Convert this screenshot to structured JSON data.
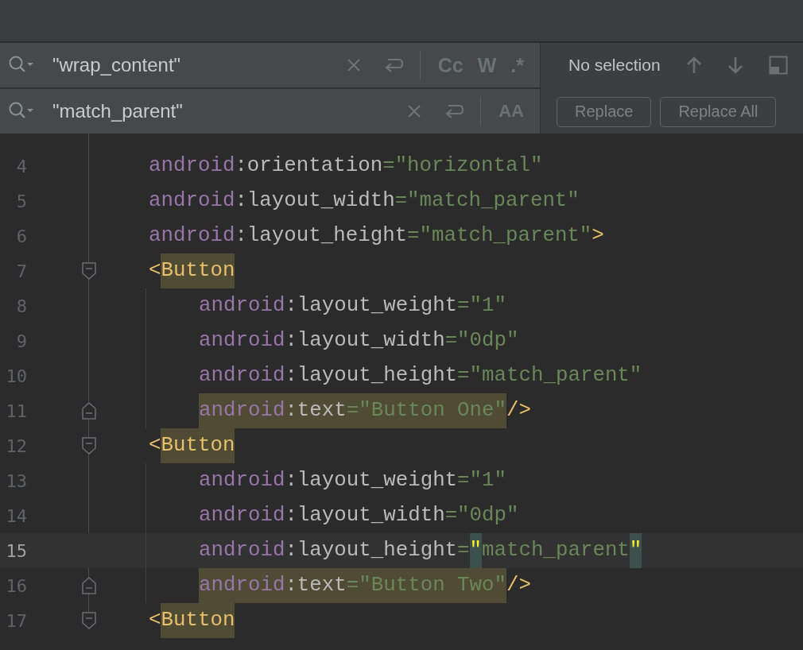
{
  "search": {
    "find_value": "\"wrap_content\"",
    "replace_value": "\"match_parent\"",
    "find_options": [
      {
        "label": "Cc",
        "selected": false
      },
      {
        "label": "W",
        "selected": false
      },
      {
        "label": ".*",
        "selected": false
      }
    ],
    "preserve_case_label": "AA",
    "status": "No selection",
    "buttons": [
      {
        "label": "Replace",
        "disabled": true
      },
      {
        "label": "Replace All",
        "disabled": true
      }
    ]
  },
  "lines": [
    {
      "number": "4",
      "current": false,
      "fold_start": false,
      "fold_end": false,
      "tokens": [
        {
          "kind": "namespace",
          "text": "android",
          "search_hit": false,
          "brace_match": false
        },
        {
          "kind": "punct",
          "text": ":orientation",
          "search_hit": false,
          "brace_match": false
        },
        {
          "kind": "string",
          "text": "=\"horizontal\"",
          "search_hit": false,
          "brace_match": false
        }
      ]
    },
    {
      "number": "5",
      "current": false,
      "fold_start": false,
      "fold_end": false,
      "tokens": [
        {
          "kind": "namespace",
          "text": "android",
          "search_hit": false,
          "brace_match": false
        },
        {
          "kind": "punct",
          "text": ":layout_width",
          "search_hit": false,
          "brace_match": false
        },
        {
          "kind": "string",
          "text": "=\"match_parent\"",
          "search_hit": false,
          "brace_match": false
        }
      ]
    },
    {
      "number": "6",
      "current": false,
      "fold_start": false,
      "fold_end": false,
      "tokens": [
        {
          "kind": "namespace",
          "text": "android",
          "search_hit": false,
          "brace_match": false
        },
        {
          "kind": "punct",
          "text": ":layout_height",
          "search_hit": false,
          "brace_match": false
        },
        {
          "kind": "string",
          "text": "=\"match_parent\"",
          "search_hit": false,
          "brace_match": false
        },
        {
          "kind": "tag",
          "text": ">",
          "search_hit": false,
          "brace_match": false
        }
      ]
    },
    {
      "number": "7",
      "current": false,
      "fold_start": true,
      "fold_end": false,
      "tokens": [
        {
          "kind": "tag",
          "text": "<",
          "search_hit": false,
          "brace_match": false
        },
        {
          "kind": "tag",
          "text": "Button",
          "search_hit": true,
          "brace_match": false
        }
      ],
      "children": [
        {
          "number": "8",
          "current": false,
          "fold_start": false,
          "fold_end": false,
          "tokens": [
            {
              "kind": "namespace",
              "text": "android",
              "search_hit": false,
              "brace_match": false
            },
            {
              "kind": "punct",
              "text": ":layout_weight",
              "search_hit": false,
              "brace_match": false
            },
            {
              "kind": "string",
              "text": "=\"1\"",
              "search_hit": false,
              "brace_match": false
            }
          ]
        },
        {
          "number": "9",
          "current": false,
          "fold_start": false,
          "fold_end": false,
          "tokens": [
            {
              "kind": "namespace",
              "text": "android",
              "search_hit": false,
              "brace_match": false
            },
            {
              "kind": "punct",
              "text": ":layout_width",
              "search_hit": false,
              "brace_match": false
            },
            {
              "kind": "string",
              "text": "=\"0dp\"",
              "search_hit": false,
              "brace_match": false
            }
          ]
        },
        {
          "number": "10",
          "current": false,
          "fold_start": false,
          "fold_end": false,
          "tokens": [
            {
              "kind": "namespace",
              "text": "android",
              "search_hit": false,
              "brace_match": false
            },
            {
              "kind": "punct",
              "text": ":layout_height",
              "search_hit": false,
              "brace_match": false
            },
            {
              "kind": "string",
              "text": "=\"match_parent\"",
              "search_hit": false,
              "brace_match": false
            }
          ]
        },
        {
          "number": "11",
          "current": false,
          "fold_start": false,
          "fold_end": true,
          "tokens": [
            {
              "kind": "namespace",
              "text": "android",
              "search_hit": true,
              "brace_match": false
            },
            {
              "kind": "punct",
              "text": ":text",
              "search_hit": true,
              "brace_match": false
            },
            {
              "kind": "string",
              "text": "=\"Button One\"",
              "search_hit": true,
              "brace_match": false
            },
            {
              "kind": "tag",
              "text": "/>",
              "search_hit": false,
              "brace_match": false
            }
          ]
        }
      ]
    },
    {
      "number": "12",
      "current": false,
      "fold_start": true,
      "fold_end": false,
      "tokens": [
        {
          "kind": "tag",
          "text": "<",
          "search_hit": false,
          "brace_match": false
        },
        {
          "kind": "tag",
          "text": "Button",
          "search_hit": true,
          "brace_match": false
        }
      ],
      "children": [
        {
          "number": "13",
          "current": false,
          "fold_start": false,
          "fold_end": false,
          "tokens": [
            {
              "kind": "namespace",
              "text": "android",
              "search_hit": false,
              "brace_match": false
            },
            {
              "kind": "punct",
              "text": ":layout_weight",
              "search_hit": false,
              "brace_match": false
            },
            {
              "kind": "string",
              "text": "=\"1\"",
              "search_hit": false,
              "brace_match": false
            }
          ]
        },
        {
          "number": "14",
          "current": false,
          "fold_start": false,
          "fold_end": false,
          "tokens": [
            {
              "kind": "namespace",
              "text": "android",
              "search_hit": false,
              "brace_match": false
            },
            {
              "kind": "punct",
              "text": ":layout_width",
              "search_hit": false,
              "brace_match": false
            },
            {
              "kind": "string",
              "text": "=\"0dp\"",
              "search_hit": false,
              "brace_match": false
            }
          ]
        },
        {
          "number": "15",
          "current": true,
          "fold_start": false,
          "fold_end": false,
          "tokens": [
            {
              "kind": "namespace",
              "text": "android",
              "search_hit": false,
              "brace_match": false
            },
            {
              "kind": "punct",
              "text": ":layout_height",
              "search_hit": false,
              "brace_match": false
            },
            {
              "kind": "string",
              "text": "=",
              "search_hit": false,
              "brace_match": false
            },
            {
              "kind": "string",
              "text": "\"",
              "search_hit": false,
              "brace_match": true
            },
            {
              "kind": "string",
              "text": "match_parent",
              "search_hit": false,
              "brace_match": false
            },
            {
              "kind": "string",
              "text": "\"",
              "search_hit": false,
              "brace_match": true
            }
          ]
        },
        {
          "number": "16",
          "current": false,
          "fold_start": false,
          "fold_end": true,
          "tokens": [
            {
              "kind": "namespace",
              "text": "android",
              "search_hit": true,
              "brace_match": false
            },
            {
              "kind": "punct",
              "text": ":text",
              "search_hit": true,
              "brace_match": false
            },
            {
              "kind": "string",
              "text": "=\"Button Two\"",
              "search_hit": true,
              "brace_match": false
            },
            {
              "kind": "tag",
              "text": "/>",
              "search_hit": false,
              "brace_match": false
            }
          ]
        }
      ]
    },
    {
      "number": "17",
      "current": false,
      "fold_start": true,
      "fold_end": false,
      "tokens": [
        {
          "kind": "tag",
          "text": "<",
          "search_hit": false,
          "brace_match": false
        },
        {
          "kind": "tag",
          "text": "Button",
          "search_hit": true,
          "brace_match": false
        }
      ]
    }
  ]
}
